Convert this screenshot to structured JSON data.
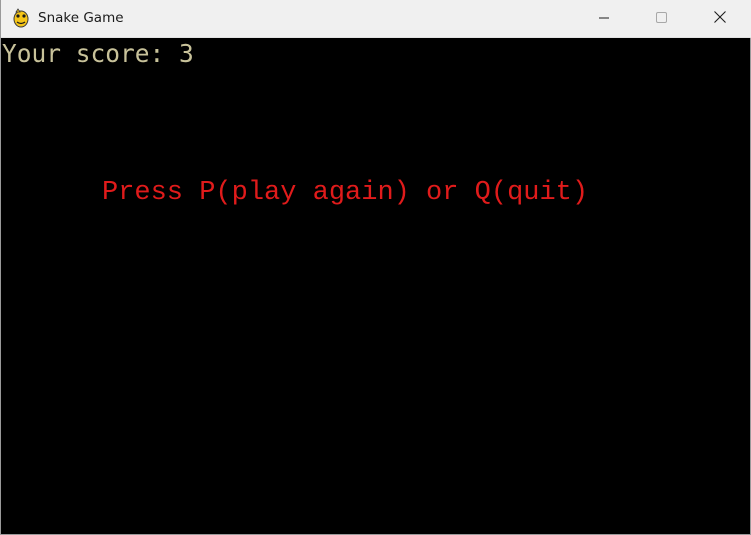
{
  "window": {
    "title": "Snake Game",
    "icon": "pygame-snake-icon"
  },
  "game": {
    "score_text": "Your score: 3",
    "message": "Press P(play again) or Q(quit)",
    "colors": {
      "background": "#000000",
      "score": "#c8c29a",
      "message": "#e01b1b"
    }
  }
}
